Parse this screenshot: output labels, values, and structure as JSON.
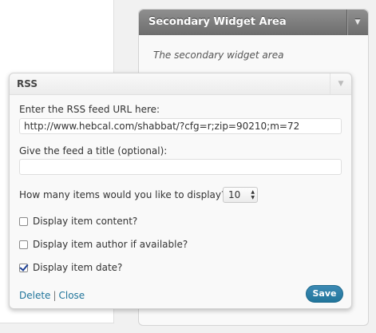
{
  "secondary_area": {
    "title": "Secondary Widget Area",
    "description": "The secondary widget area"
  },
  "rss_widget": {
    "title": "RSS",
    "url_label": "Enter the RSS feed URL here:",
    "url_value": "http://www.hebcal.com/shabbat/?cfg=r;zip=90210;m=72",
    "title_label": "Give the feed a title (optional):",
    "title_value": "",
    "items_label": "How many items would you like to display?",
    "items_value": "10",
    "checkboxes": [
      {
        "label": "Display item content?",
        "checked": false
      },
      {
        "label": "Display item author if available?",
        "checked": false
      },
      {
        "label": "Display item date?",
        "checked": true
      }
    ],
    "delete_label": "Delete",
    "separator": "|",
    "close_label": "Close",
    "save_label": "Save"
  },
  "colors": {
    "accent": "#21759b",
    "header_dark": "#6d6d6d"
  }
}
